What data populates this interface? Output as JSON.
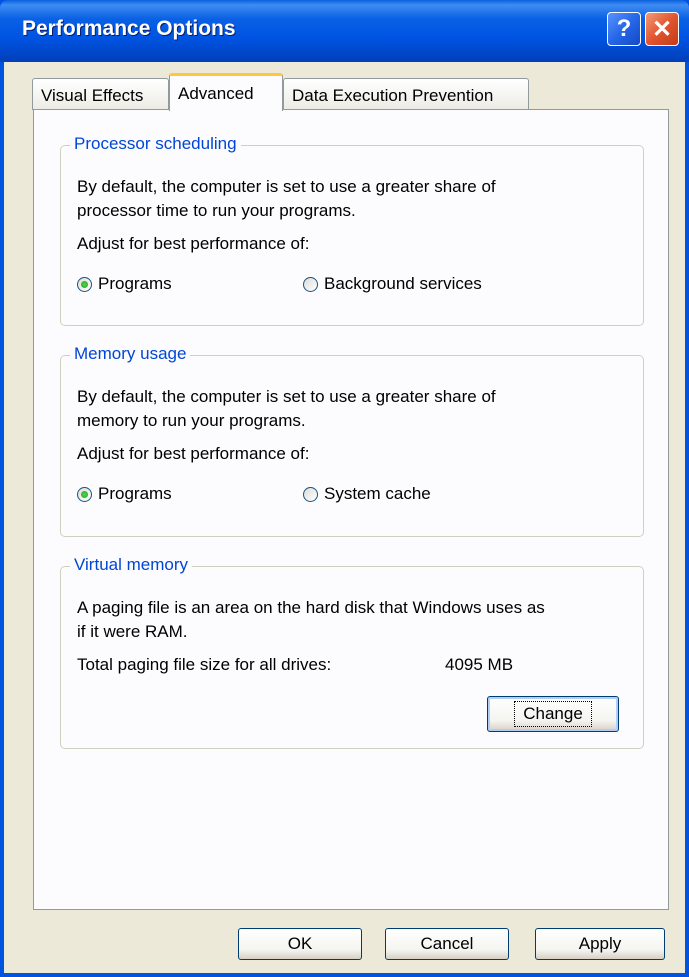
{
  "window": {
    "title": "Performance Options",
    "help_glyph": "?",
    "close_glyph": "✕"
  },
  "tabs": [
    {
      "label": "Visual Effects",
      "active": false
    },
    {
      "label": "Advanced",
      "active": true
    },
    {
      "label": "Data Execution Prevention",
      "active": false
    }
  ],
  "processor": {
    "title": "Processor scheduling",
    "description_line1": "By default, the computer is set to use a greater share of",
    "description_line2": "processor time to run your programs.",
    "adjust_label": "Adjust for best performance of:",
    "options": [
      {
        "label": "Programs",
        "checked": true
      },
      {
        "label": "Background services",
        "checked": false
      }
    ]
  },
  "memory": {
    "title": "Memory usage",
    "description_line1": "By default, the computer is set to use a greater share of",
    "description_line2": "memory to run your programs.",
    "adjust_label": "Adjust for best performance of:",
    "options": [
      {
        "label": "Programs",
        "checked": true
      },
      {
        "label": "System cache",
        "checked": false
      }
    ]
  },
  "virtual_memory": {
    "title": "Virtual memory",
    "description_line1": "A paging file is an area on the hard disk that Windows uses as",
    "description_line2": "if it were RAM.",
    "total_label": "Total paging file size for all drives:",
    "total_value": "4095 MB",
    "change_button": "Change"
  },
  "footer": {
    "ok": "OK",
    "cancel": "Cancel",
    "apply": "Apply"
  },
  "colors": {
    "title_bar": "#0054e3",
    "group_title": "#0046d5",
    "active_tab_accent": "#ffc73c",
    "radio_checked": "#21a121"
  }
}
